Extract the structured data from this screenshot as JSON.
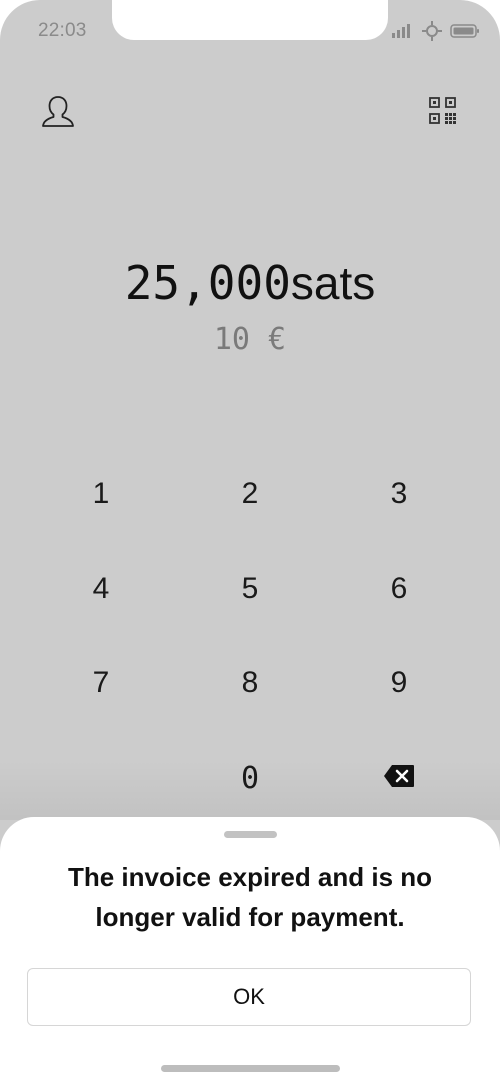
{
  "status_bar": {
    "time": "22:03",
    "icons": [
      "signal-icon",
      "network-icon",
      "battery-icon"
    ]
  },
  "header": {
    "profile_icon": "user-icon",
    "qr_icon": "qr-code-icon"
  },
  "amount": {
    "value": "25,000",
    "unit": "sats"
  },
  "fiat": {
    "value": "10 €"
  },
  "keypad": {
    "keys": [
      "1",
      "2",
      "3",
      "4",
      "5",
      "6",
      "7",
      "8",
      "9",
      "0"
    ],
    "backspace_icon": "backspace-icon"
  },
  "sheet": {
    "message_line1": "The invoice expired and is no",
    "message_line2": "longer valid for payment.",
    "ok_label": "OK"
  },
  "colors": {
    "background": "#cccccc",
    "sheet": "#ffffff",
    "text": "#111111",
    "muted": "#7a7a7a"
  }
}
